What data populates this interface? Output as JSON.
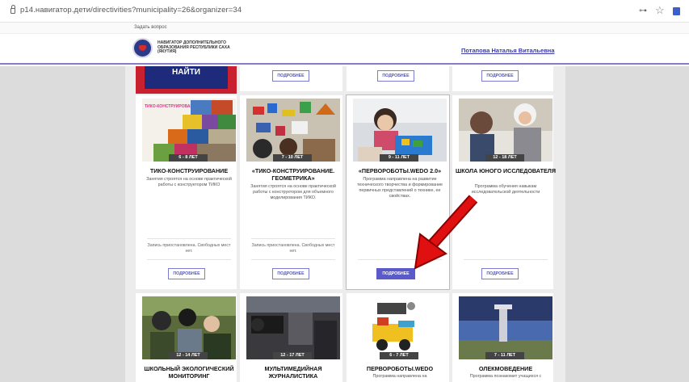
{
  "browser": {
    "url": "p14.навигатор.дети/directivities?municipality=26&organizer=34"
  },
  "topbar": {
    "ask_link": "Задать вопрос"
  },
  "header": {
    "brand": "НАВИГАТОР ДОПОЛНИТЕЛЬНОГО ОБРАЗОВАНИЯ РЕСПУБЛИКИ САХА (ЯКУТИЯ)",
    "user": "Потапова Наталья Витальевна"
  },
  "find_button": "НАЙТИ",
  "more_label": "ПОДРОБНЕЕ",
  "cards_row1": [
    {
      "age": "6 - 8 ЛЕТ",
      "title": "ТИКО-КОНСТРУИРОВАНИЕ",
      "desc": "Занятия строятся на основе практической работы с конструктором ТИКО",
      "status": "Запись приостановлена. Свободных мест нет."
    },
    {
      "age": "7 - 10 ЛЕТ",
      "title": "«ТИКО-КОНСТРУИРОВАНИЕ. ГЕОМЕТРИКА»",
      "desc": "Занятия строятся на основе практической работы с конструктором для объемного моделирования ТИКО.",
      "status": "Запись приостановлена. Свободных мест нет."
    },
    {
      "age": "9 - 11 ЛЕТ",
      "title": "«ПЕРВОРОБОТЫ.WEDO 2.0»",
      "desc": "Программа направлена на развитие технического творчества и формирование первичных представлений о технике, ее свойствах.",
      "status": ""
    },
    {
      "age": "12 - 18 ЛЕТ",
      "title": "ШКОЛА ЮНОГО ИССЛЕДОВАТЕЛЯ",
      "desc": "Программа обучения навыкам исследовательской деятельности",
      "status": ""
    }
  ],
  "cards_row2": [
    {
      "age": "12 - 14 ЛЕТ",
      "title": "ШКОЛЬНЫЙ ЭКОЛОГИЧЕСКИЙ МОНИТОРИНГ",
      "desc": ""
    },
    {
      "age": "12 - 17 ЛЕТ",
      "title": "МУЛЬТИМЕДИЙНАЯ ЖУРНАЛИСТИКА",
      "desc": ""
    },
    {
      "age": "6 - 7 ЛЕТ",
      "title": "ПЕРВОРОБОТЫ.WEDO",
      "desc": "Программа направлена на"
    },
    {
      "age": "7 - 11 ЛЕТ",
      "title": "ОЛЕКМОВЕДЕНИЕ",
      "desc": "Программа познакомит учащихся с"
    }
  ],
  "colors": {
    "accent": "#5a5ac8",
    "annotation_arrow": "#e01010",
    "find_bg": "#1d2b7a"
  }
}
